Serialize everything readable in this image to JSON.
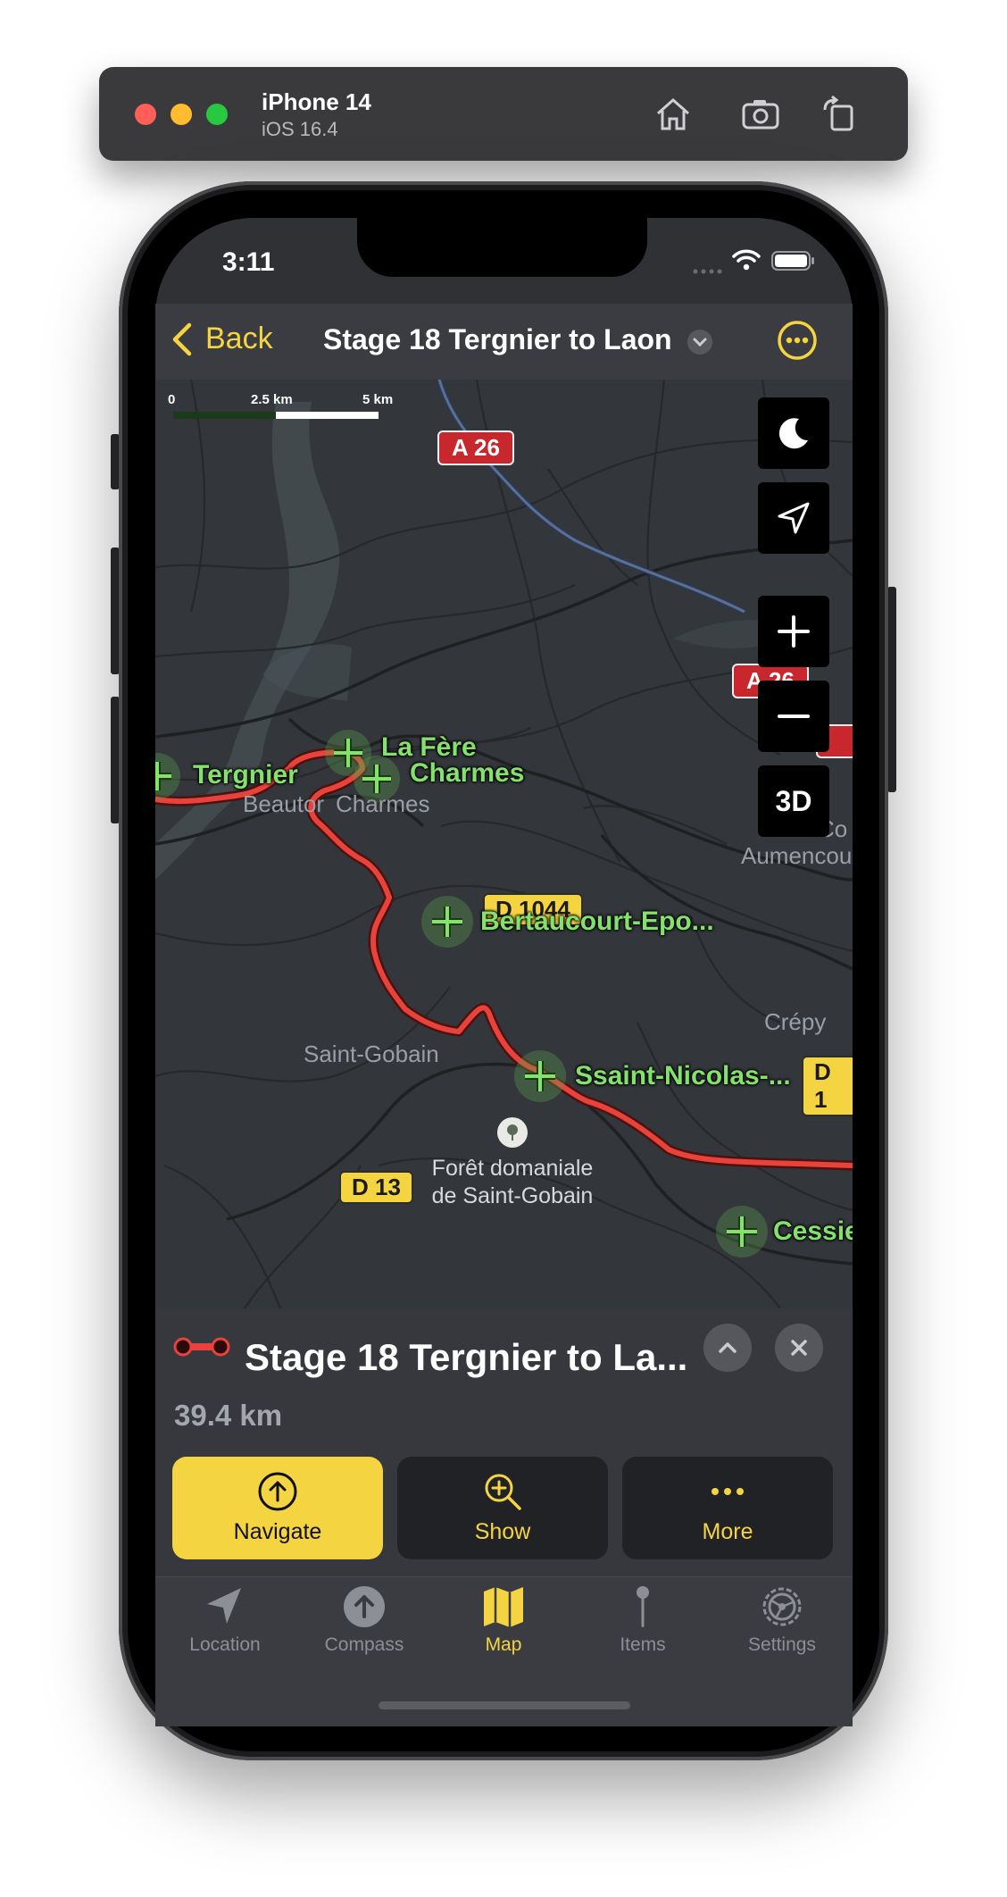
{
  "simulator": {
    "device": "iPhone 14",
    "os": "iOS 16.4",
    "icons": [
      "home-icon",
      "screenshot-icon",
      "rotate-icon"
    ]
  },
  "status_bar": {
    "time": "3:11"
  },
  "header": {
    "back_label": "Back",
    "title": "Stage 18 Tergnier to Laon"
  },
  "map": {
    "scale": {
      "zero": "0",
      "mid": "2.5 km",
      "max": "5 km"
    },
    "controls": {
      "three_d": "3D"
    },
    "roads": {
      "a26_top": "A 26",
      "a26_side": "A 26",
      "d1044": "D 1044",
      "d13": "D 13",
      "d1_partial": "D 1"
    },
    "waypoints": {
      "tergnier": "Tergnier",
      "la_fere": "La Fère",
      "charmes": "Charmes",
      "bertaucourt": "Bertaucourt-Epo...",
      "ssaint_nicolas": "Ssaint-Nicolas-...",
      "cessieres": "Cessie"
    },
    "places": {
      "beautor": "Beautor",
      "charmes_place": "Charmes",
      "saint_gobain": "Saint-Gobain",
      "crepy": "Crépy",
      "aumencourt": "Aumencou",
      "co_partial": "Co",
      "foret": "Forêt domaniale de Saint-Gobain"
    }
  },
  "sheet": {
    "title": "Stage 18 Tergnier to La...",
    "distance": "39.4 km",
    "actions": {
      "navigate": "Navigate",
      "show": "Show",
      "more": "More"
    }
  },
  "tabs": {
    "location": "Location",
    "compass": "Compass",
    "map": "Map",
    "items": "Items",
    "settings": "Settings"
  },
  "colors": {
    "accent": "#f5d442",
    "route": "#e8423a",
    "waypoint": "#84e16c",
    "map_bg": "#33363b",
    "bar_bg": "#3a3c41"
  }
}
